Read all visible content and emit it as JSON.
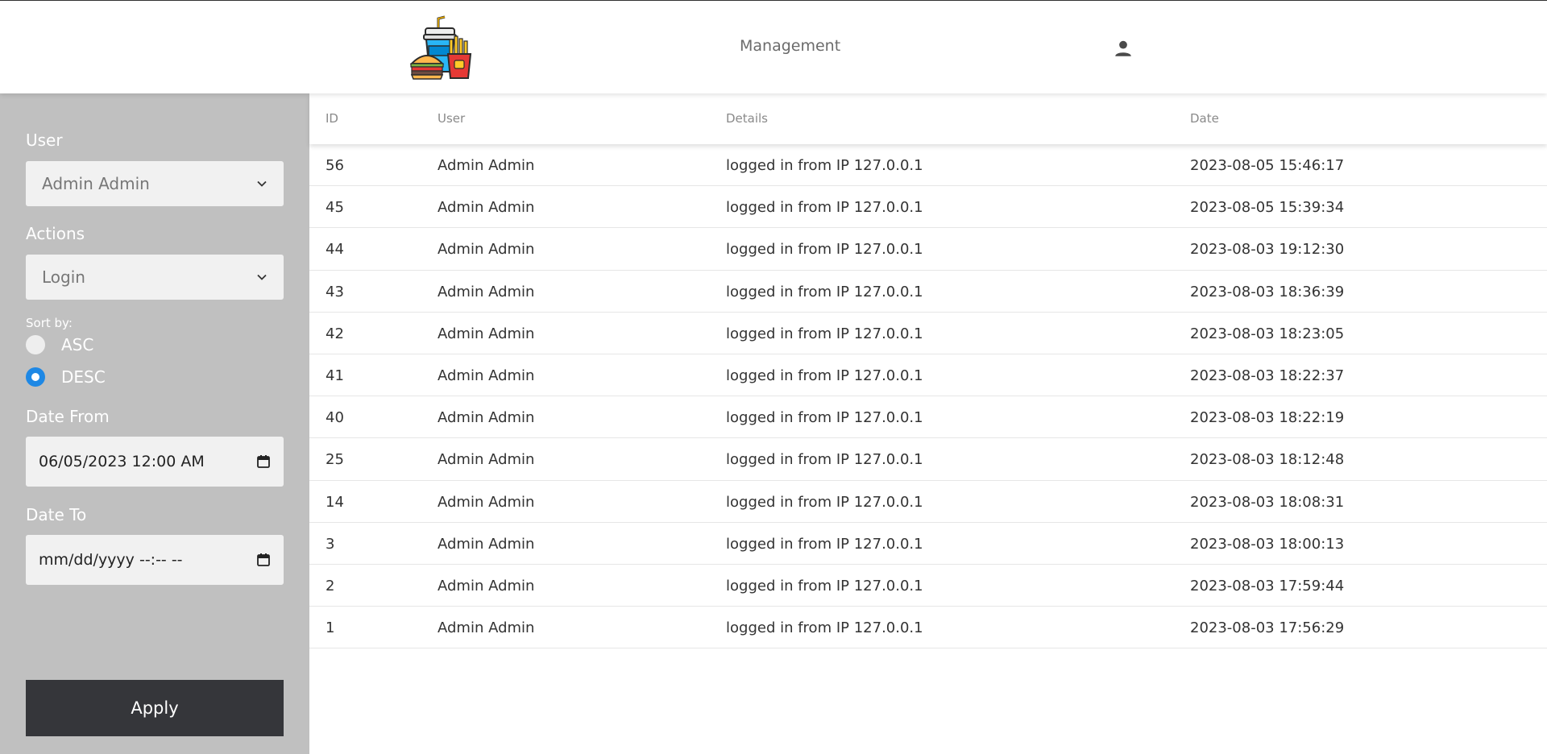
{
  "header": {
    "logo_icon": "fast-food-logo-icon",
    "nav_management": "Management",
    "user_icon": "person-icon"
  },
  "filters": {
    "user_label": "User",
    "user_value": "Admin Admin",
    "actions_label": "Actions",
    "actions_value": "Login",
    "sort_label": "Sort by:",
    "sort_asc": "ASC",
    "sort_desc": "DESC",
    "sort_selected": "DESC",
    "date_from_label": "Date From",
    "date_from_value": "06/05/2023 12:00 AM",
    "date_to_label": "Date To",
    "date_to_value": "mm/dd/yyyy --:-- --",
    "apply_label": "Apply"
  },
  "table": {
    "headers": {
      "id": "ID",
      "user": "User",
      "details": "Details",
      "date": "Date"
    },
    "rows": [
      {
        "id": "56",
        "user": "Admin Admin",
        "details": "logged in from IP 127.0.0.1",
        "date": "2023-08-05 15:46:17"
      },
      {
        "id": "45",
        "user": "Admin Admin",
        "details": "logged in from IP 127.0.0.1",
        "date": "2023-08-05 15:39:34"
      },
      {
        "id": "44",
        "user": "Admin Admin",
        "details": "logged in from IP 127.0.0.1",
        "date": "2023-08-03 19:12:30"
      },
      {
        "id": "43",
        "user": "Admin Admin",
        "details": "logged in from IP 127.0.0.1",
        "date": "2023-08-03 18:36:39"
      },
      {
        "id": "42",
        "user": "Admin Admin",
        "details": "logged in from IP 127.0.0.1",
        "date": "2023-08-03 18:23:05"
      },
      {
        "id": "41",
        "user": "Admin Admin",
        "details": "logged in from IP 127.0.0.1",
        "date": "2023-08-03 18:22:37"
      },
      {
        "id": "40",
        "user": "Admin Admin",
        "details": "logged in from IP 127.0.0.1",
        "date": "2023-08-03 18:22:19"
      },
      {
        "id": "25",
        "user": "Admin Admin",
        "details": "logged in from IP 127.0.0.1",
        "date": "2023-08-03 18:12:48"
      },
      {
        "id": "14",
        "user": "Admin Admin",
        "details": "logged in from IP 127.0.0.1",
        "date": "2023-08-03 18:08:31"
      },
      {
        "id": "3",
        "user": "Admin Admin",
        "details": "logged in from IP 127.0.0.1",
        "date": "2023-08-03 18:00:13"
      },
      {
        "id": "2",
        "user": "Admin Admin",
        "details": "logged in from IP 127.0.0.1",
        "date": "2023-08-03 17:59:44"
      },
      {
        "id": "1",
        "user": "Admin Admin",
        "details": "logged in from IP 127.0.0.1",
        "date": "2023-08-03 17:56:29"
      }
    ]
  },
  "colors": {
    "sidebar_bg": "#c0c0c0",
    "apply_bg": "#35363a",
    "radio_accent": "#1e88e5"
  }
}
